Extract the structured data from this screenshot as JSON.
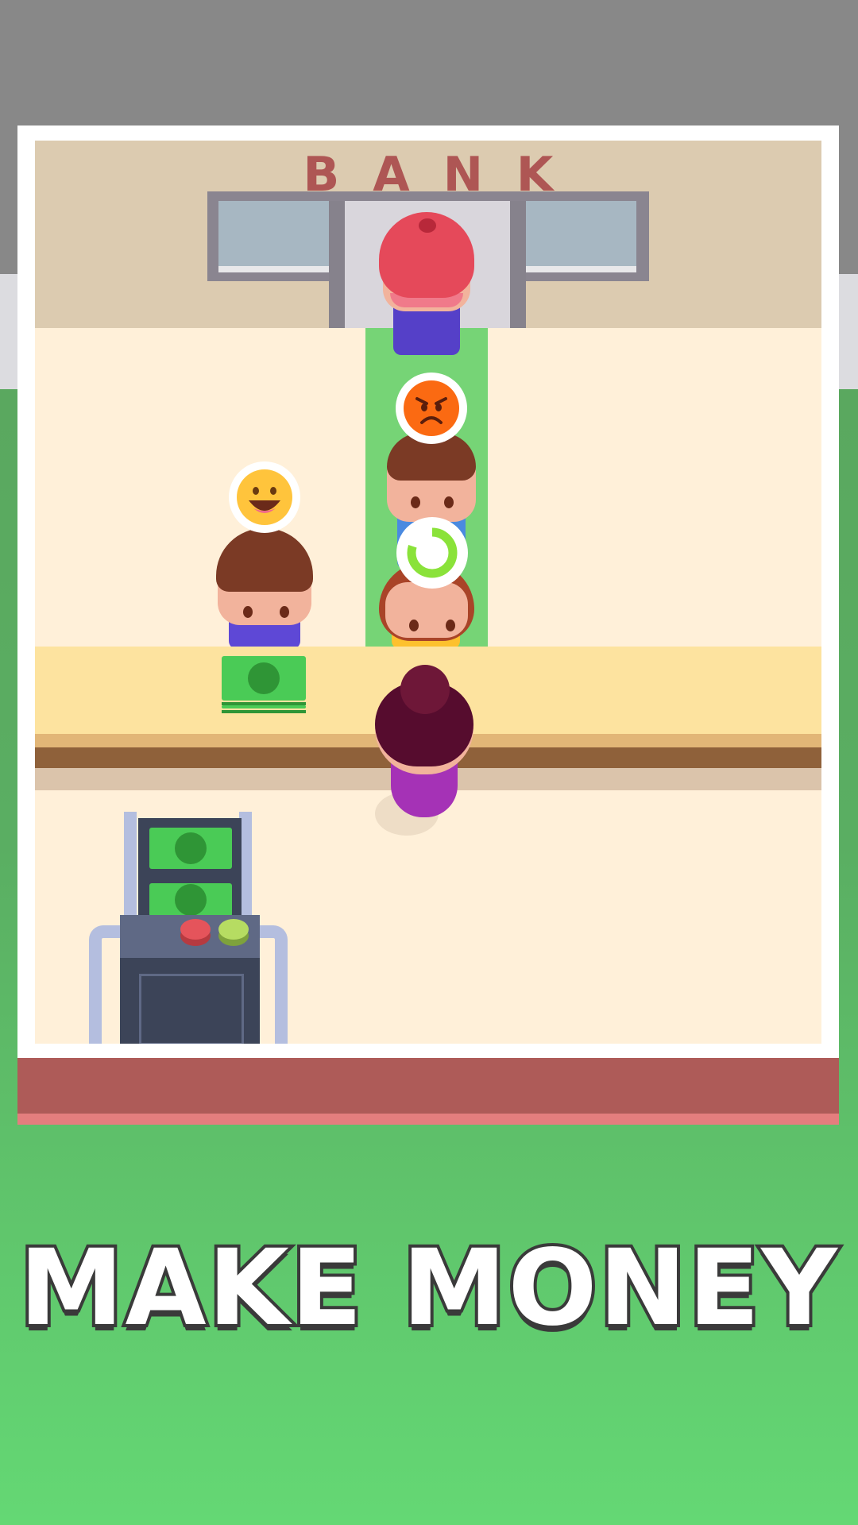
{
  "scene": {
    "sign": "BANK",
    "title": "MAKE MONEY"
  },
  "customers": [
    {
      "position": "window",
      "mood": "none"
    },
    {
      "position": "queue-1",
      "mood": "angry-emoji-icon"
    },
    {
      "position": "queue-2",
      "mood": "loading-ring-icon",
      "progress": 0.8
    },
    {
      "position": "counter-left",
      "mood": "happy-emoji-icon"
    }
  ],
  "colors": {
    "sign": "#ae5654",
    "lane": "#76d476",
    "cash": "#4acb56",
    "title_fill": "#ffffff",
    "title_outline": "#3a3a3a"
  }
}
